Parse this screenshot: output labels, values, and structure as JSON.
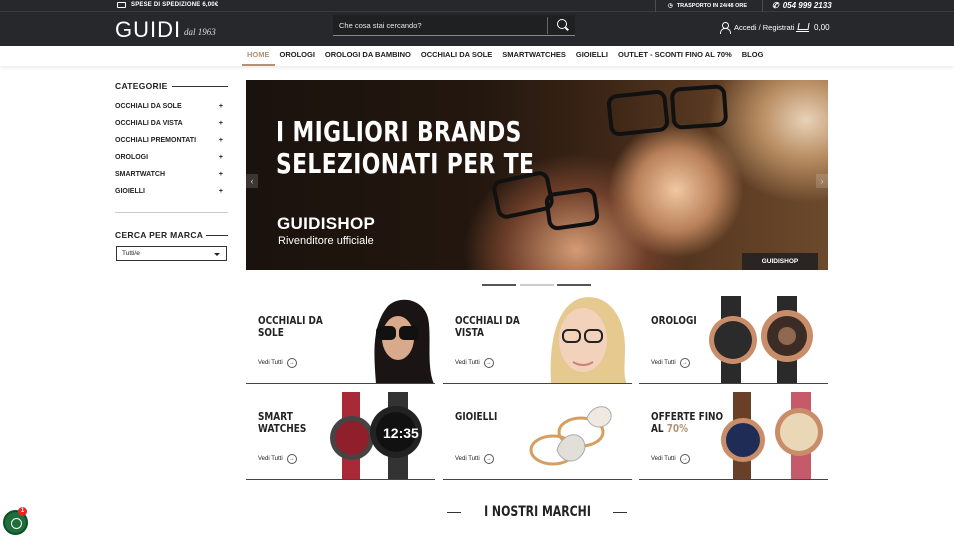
{
  "topbar": {
    "shipping_label": "SPESE DI SPEDIZIONE 6,00€",
    "transport_label": "TRASPORTO IN 24/48 ORE",
    "phone": "054 999 2133"
  },
  "header": {
    "logo": "GUIDI",
    "logo_tagline": "dal 1963",
    "search_placeholder": "Che cosa stai cercando?",
    "account_label": "Accedi / Registrati",
    "cart_total": "0,00"
  },
  "nav": {
    "items": [
      "HOME",
      "OROLOGI",
      "OROLOGI DA BAMBINO",
      "OCCHIALI DA SOLE",
      "SMARTWATCHES",
      "GIOIELLI",
      "OUTLET - SCONTI FINO AL 70%",
      "BLOG"
    ],
    "active": "HOME"
  },
  "sidebar": {
    "categories_title": "CATEGORIE",
    "categories": [
      "OCCHIALI DA SOLE",
      "OCCHIALI DA VISTA",
      "OCCHIALI PREMONTATI",
      "OROLOGI",
      "SMARTWATCH",
      "GIOIELLI"
    ],
    "expand_symbol": "+",
    "brand_title": "CERCA PER MARCA",
    "brand_select_value": "Tutti/e"
  },
  "hero": {
    "headline_1": "I MIGLIORI BRANDS",
    "headline_2": "SELEZIONATI PER TE",
    "brand": "GUIDISHOP",
    "subtitle": "Rivenditore ufficiale",
    "badge": "GUIDISHOP",
    "prev": "‹",
    "next": "›"
  },
  "tiles": [
    {
      "title": "OCCHIALI DA SOLE",
      "link": "Vedi Tutti"
    },
    {
      "title": "OCCHIALI DA VISTA",
      "link": "Vedi Tutti"
    },
    {
      "title": "OROLOGI",
      "link": "Vedi Tutti"
    },
    {
      "title": "SMART WATCHES",
      "link": "Vedi Tutti"
    },
    {
      "title": "GIOIELLI",
      "link": "Vedi Tutti"
    },
    {
      "title_1": "OFFERTE FINO",
      "title_2a": "AL ",
      "title_2b": "70%",
      "link": "Vedi Tutti"
    }
  ],
  "brands_heading": "I NOSTRI MARCHI",
  "whatsapp_badge": "1",
  "colors": {
    "accent": "#b39277",
    "topbar": "#26282b"
  }
}
